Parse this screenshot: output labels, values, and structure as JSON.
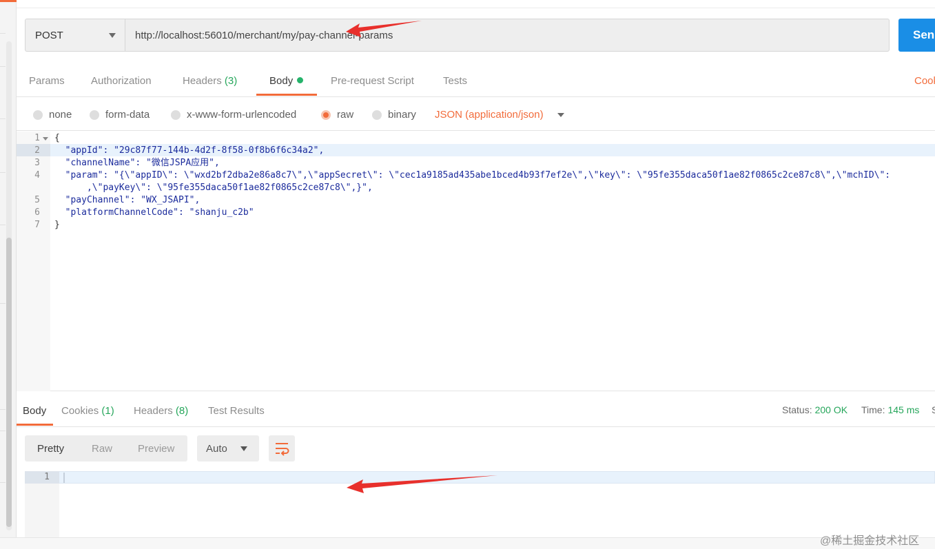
{
  "request": {
    "method": "POST",
    "url": "http://localhost:56010/merchant/my/pay-channel-params",
    "send_label": "Sen"
  },
  "request_tabs": [
    {
      "label": "Params",
      "count": ""
    },
    {
      "label": "Authorization",
      "count": ""
    },
    {
      "label": "Headers",
      "count": "(3)"
    },
    {
      "label": "Body",
      "count": ""
    },
    {
      "label": "Pre-request Script",
      "count": ""
    },
    {
      "label": "Tests",
      "count": ""
    }
  ],
  "cookies_label": "Cooki",
  "body_types": [
    "none",
    "form-data",
    "x-www-form-urlencoded",
    "raw",
    "binary"
  ],
  "selected_body_type": "raw",
  "content_type": "JSON (application/json)",
  "editor": {
    "line_numbers": [
      "1",
      "2",
      "3",
      "4",
      "",
      "5",
      "6",
      "7"
    ],
    "lines": [
      "{",
      "  \"appId\": \"29c87f77-144b-4d2f-8f58-0f8b6f6c34a2\",",
      "  \"channelName\": \"微信JSPA应用\",",
      "  \"param\": \"{\\\"appID\\\": \\\"wxd2bf2dba2e86a8c7\\\",\\\"appSecret\\\": \\\"cec1a9185ad435abe1bced4b93f7ef2e\\\",\\\"key\\\": \\\"95fe355daca50f1ae82f0865c2ce87c8\\\",\\\"mchID\\\":",
      "      ,\\\"payKey\\\": \\\"95fe355daca50f1ae82f0865c2ce87c8\\\",}\",",
      "  \"payChannel\": \"WX_JSAPI\",",
      "  \"platformChannelCode\": \"shanju_c2b\"",
      "}"
    ]
  },
  "response_tabs": [
    {
      "label": "Body",
      "count": ""
    },
    {
      "label": "Cookies",
      "count": "(1)"
    },
    {
      "label": "Headers",
      "count": "(8)"
    },
    {
      "label": "Test Results",
      "count": ""
    }
  ],
  "response_status": {
    "status_label": "Status:",
    "status_value": "200 OK",
    "time_label": "Time:",
    "time_value": "145 ms",
    "size_label": "S"
  },
  "response_views": [
    "Pretty",
    "Raw",
    "Preview"
  ],
  "response_format": "Auto",
  "response_line_numbers": [
    "1"
  ],
  "watermark": "@稀土掘金技术社区",
  "colors": {
    "accent": "#f26b3a",
    "send": "#1a8ee6",
    "success": "#26a65b",
    "annotation_arrow": "#e8302c"
  },
  "icons": [
    "caret-down-icon",
    "wrap-lines-icon",
    "status-dot-icon",
    "fold-arrow-icon"
  ]
}
